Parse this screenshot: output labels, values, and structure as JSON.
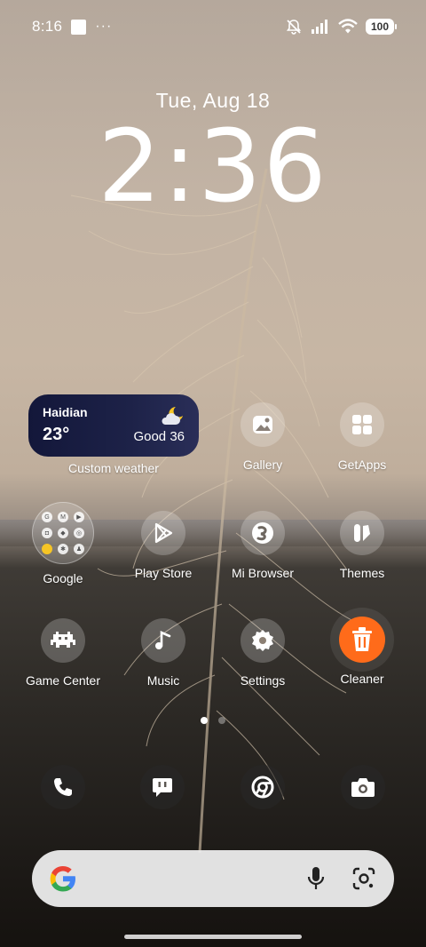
{
  "status_bar": {
    "time": "8:16",
    "overflow": "···",
    "battery": "100",
    "icons": [
      "mute-icon",
      "signal-icon",
      "wifi-icon",
      "battery-icon"
    ]
  },
  "lockclock": {
    "date": "Tue, Aug 18",
    "time": "2:36"
  },
  "weather": {
    "city": "Haidian",
    "temperature": "23°",
    "air_quality": "Good 36",
    "label": "Custom weather",
    "icon": "partly-cloudy-night-icon"
  },
  "apps": {
    "gallery": "Gallery",
    "getapps": "GetApps",
    "google": "Google",
    "play_store": "Play Store",
    "mi_browser": "Mi Browser",
    "themes": "Themes",
    "game_center": "Game Center",
    "music": "Music",
    "settings": "Settings",
    "cleaner": "Cleaner"
  },
  "google_folder": {
    "items": [
      "G",
      "M",
      "▶",
      "◘",
      "◆",
      "◎",
      "●",
      "✱",
      "♟"
    ]
  },
  "dock": [
    "phone-icon",
    "messages-icon",
    "chrome-icon",
    "camera-icon"
  ],
  "search": {
    "logo": "G",
    "icons": [
      "google-logo-icon",
      "microphone-icon",
      "lens-icon"
    ]
  },
  "pages": {
    "count": 2,
    "active": 1
  },
  "colors": {
    "cleaner": "#ff6b1a",
    "weather_bg": "#13173a",
    "search_bg": "#ececec"
  }
}
